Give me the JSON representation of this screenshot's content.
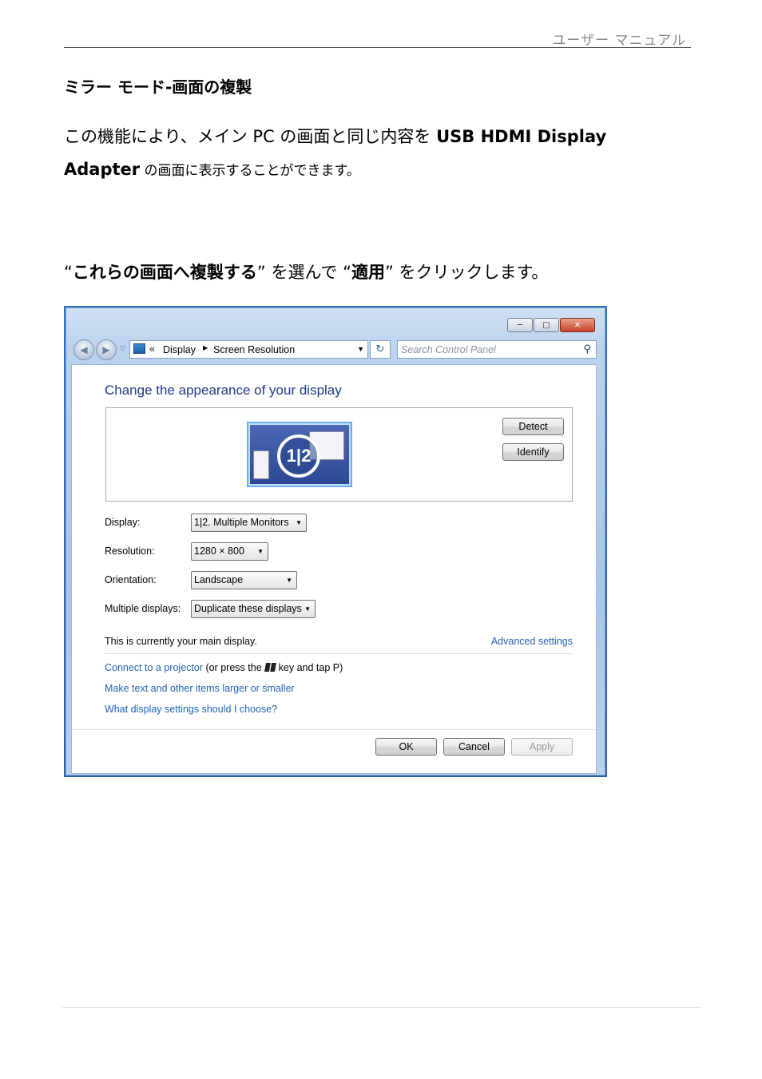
{
  "header": {
    "manual_title": "ユーザー マニュアル"
  },
  "doc": {
    "section_title": "ミラー モード-画面の複製",
    "para1_prefix": "この機能により、メイン PC の画面と同じ内容を ",
    "para1_bold": "USB HDMI Display",
    "para2_bold": "Adapter",
    "para2_suffix": " の画面に表示することができます。",
    "instr_q1": "“",
    "instr_bold1": "これらの画面へ複製する",
    "instr_mid": "” を選んで “",
    "instr_bold2": "適用",
    "instr_end": "” をクリックします。"
  },
  "window": {
    "address": {
      "chevron": "«",
      "crumb1": "Display",
      "crumb2": "Screen Resolution"
    },
    "search": {
      "placeholder": "Search Control Panel"
    },
    "heading": "Change the appearance of your display",
    "monitor_label": "1|2",
    "detect_label": "Detect",
    "identify_label": "Identify",
    "fields": [
      {
        "label": "Display:",
        "value": "1|2. Multiple Monitors"
      },
      {
        "label": "Resolution:",
        "value": "1280 × 800"
      },
      {
        "label": "Orientation:",
        "value": "Landscape"
      },
      {
        "label": "Multiple displays:",
        "value": "Duplicate these displays"
      }
    ],
    "main_note": "This is currently your main display.",
    "advanced_link": "Advanced settings",
    "projector_link": "Connect to a projector",
    "projector_text_a": "(or press the",
    "projector_text_b": "key and tap P)",
    "text_size_link": "Make text and other items larger or smaller",
    "help_link": "What display settings should I choose?",
    "ok_label": "OK",
    "cancel_label": "Cancel",
    "apply_label": "Apply"
  },
  "colors": {
    "link": "#1f63b5",
    "heading": "#1e3a8a",
    "frame": "#2f72c4"
  },
  "icons": [
    "back-arrow-icon",
    "forward-arrow-icon",
    "computer-icon",
    "refresh-icon",
    "search-icon",
    "windows-key-icon",
    "minimize-icon",
    "maximize-icon",
    "close-icon"
  ]
}
